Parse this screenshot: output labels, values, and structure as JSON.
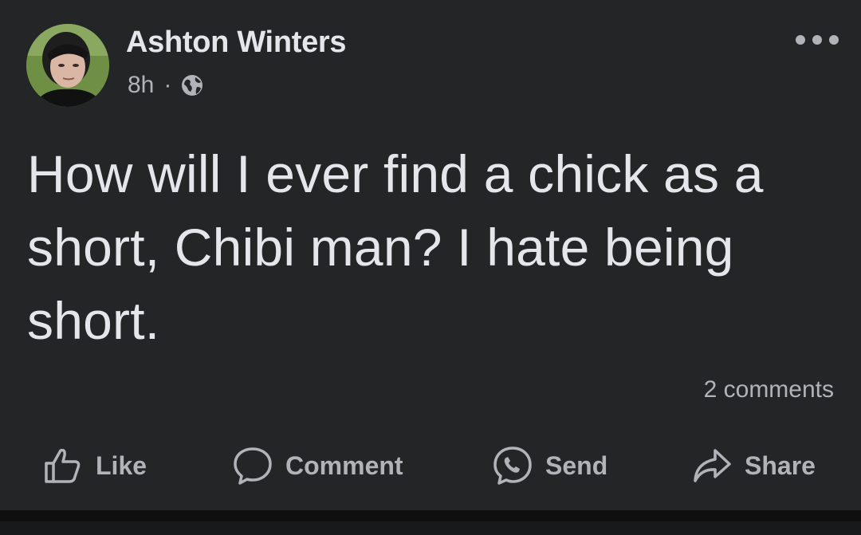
{
  "post": {
    "author": "Ashton Winters",
    "time": "8h",
    "separator": "·",
    "privacy_icon": "globe-icon",
    "text": "How will I ever find a chick as a short, Chibi man? I hate being short.",
    "comments_count": "2 comments"
  },
  "actions": {
    "like": {
      "label": "Like",
      "icon": "thumbs-up-icon"
    },
    "comment": {
      "label": "Comment",
      "icon": "comment-bubble-icon"
    },
    "send": {
      "label": "Send",
      "icon": "messenger-icon"
    },
    "share": {
      "label": "Share",
      "icon": "share-arrow-icon"
    }
  },
  "colors": {
    "background": "#242526",
    "primary_text": "#e4e6eb",
    "secondary_text": "#b0b3b8",
    "divider": "#0f0f10"
  }
}
